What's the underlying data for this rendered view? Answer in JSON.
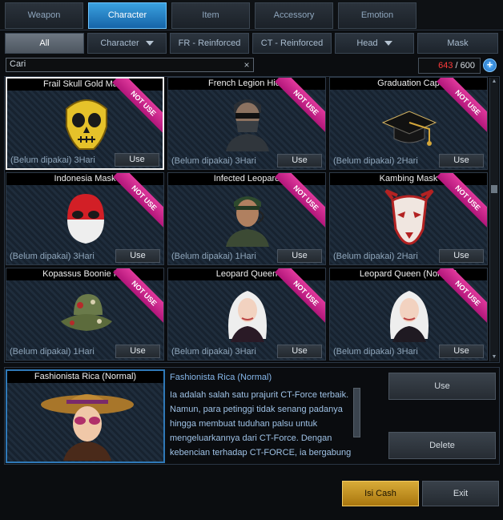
{
  "top_tabs": [
    {
      "label": "Weapon"
    },
    {
      "label": "Character",
      "active": true
    },
    {
      "label": "Item"
    },
    {
      "label": "Accessory"
    },
    {
      "label": "Emotion"
    }
  ],
  "sub_tabs": [
    {
      "label": "All",
      "active": true
    },
    {
      "label": "Character",
      "dropdown": true
    },
    {
      "label": "FR - Reinforced"
    },
    {
      "label": "CT - Reinforced"
    },
    {
      "label": "Head",
      "dropdown": true
    },
    {
      "label": "Mask"
    }
  ],
  "search": {
    "value": "Cari",
    "clear": "×"
  },
  "capacity": {
    "used": "643",
    "total": "600",
    "separator": " / "
  },
  "add_symbol": "+",
  "ribbon_text": "NOT USE",
  "items": [
    {
      "name": "Frail Skull Gold Mask",
      "status": "(Belum dipakai) 3Hari",
      "use": "Use",
      "icon": "skull-mask-icon",
      "selected": true
    },
    {
      "name": "French Legion Hide",
      "status": "(Belum dipakai) 3Hari",
      "use": "Use",
      "icon": "soldier-icon"
    },
    {
      "name": "Graduation Cap",
      "status": "(Belum dipakai) 2Hari",
      "use": "Use",
      "icon": "graduation-cap-icon"
    },
    {
      "name": "Indonesia Mask",
      "status": "(Belum dipakai) 3Hari",
      "use": "Use",
      "icon": "flag-mask-icon"
    },
    {
      "name": "Infected Leopard",
      "status": "(Belum dipakai) 1Hari",
      "use": "Use",
      "icon": "soldier-icon"
    },
    {
      "name": "Kambing Mask",
      "status": "(Belum dipakai) 2Hari",
      "use": "Use",
      "icon": "goat-mask-icon"
    },
    {
      "name": "Kopassus Boonie Hat",
      "status": "(Belum dipakai) 1Hari",
      "use": "Use",
      "icon": "boonie-hat-icon"
    },
    {
      "name": "Leopard Queen",
      "status": "(Belum dipakai) 3Hari",
      "use": "Use",
      "icon": "female-character-icon"
    },
    {
      "name": "Leopard Queen (Normal)",
      "status": "(Belum dipakai) 3Hari",
      "use": "Use",
      "icon": "female-character-icon"
    }
  ],
  "detail": {
    "preview_title": "Fashionista Rica (Normal)",
    "name": "Fashionista Rica (Normal)",
    "description": "Ia adalah salah satu prajurit CT-Force terbaik. Namun, para petinggi tidak senang padanya hingga membuat tuduhan palsu untuk mengeluarkannya dari CT-Force. Dengan kebencian terhadap CT-FORCE, ia bergabung dengan FREE REBELS menyamar sebagai reporter dan menyusun ke",
    "use_label": "Use",
    "delete_label": "Delete"
  },
  "footer": {
    "cash_label": "Isi Cash",
    "exit_label": "Exit"
  },
  "colors": {
    "accent": "#1f7fd0",
    "capacity_over": "#ff3b3b",
    "ribbon": "#d02a8e",
    "cash": "#c8961e"
  }
}
